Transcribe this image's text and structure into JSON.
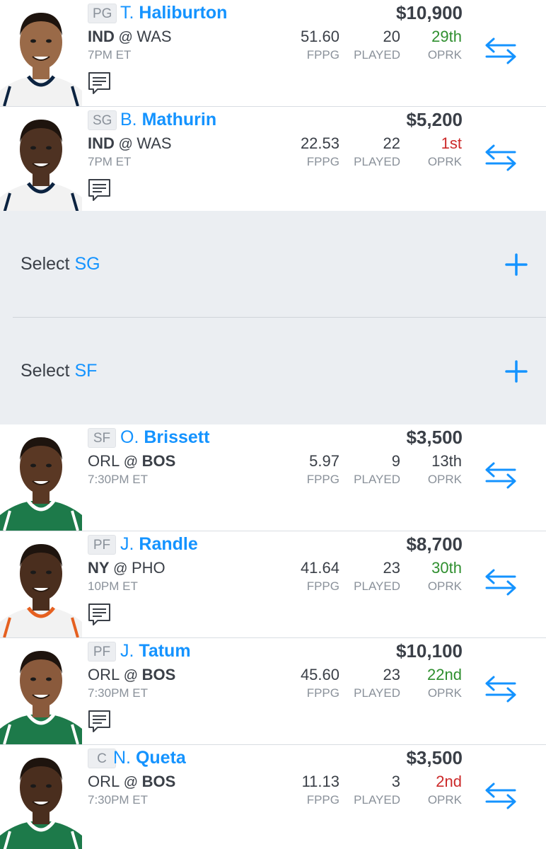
{
  "players": [
    {
      "pos": "PG",
      "first": "T.",
      "last": "Haliburton",
      "salary": "$10,900",
      "team": "IND",
      "at": "@",
      "opp": "WAS",
      "team_bold": "team",
      "time": "7PM ET",
      "fppg": "51.60",
      "played": "20",
      "oprk": "29th",
      "oprk_color": "#2f8f2f",
      "has_note": true,
      "jersey": "#f2f2f2",
      "trim": "#0c2340",
      "skin": "#9a6a48"
    },
    {
      "pos": "SG",
      "first": "B.",
      "last": "Mathurin",
      "salary": "$5,200",
      "team": "IND",
      "at": "@",
      "opp": "WAS",
      "team_bold": "team",
      "time": "7PM ET",
      "fppg": "22.53",
      "played": "22",
      "oprk": "1st",
      "oprk_color": "#cc2a2a",
      "has_note": true,
      "jersey": "#f2f2f2",
      "trim": "#0c2340",
      "skin": "#4e3222"
    },
    {
      "pos": "SF",
      "first": "O.",
      "last": "Brissett",
      "salary": "$3,500",
      "team": "ORL",
      "at": "@",
      "opp": "BOS",
      "team_bold": "opp",
      "time": "7:30PM ET",
      "fppg": "5.97",
      "played": "9",
      "oprk": "13th",
      "oprk_color": "#3a3f47",
      "has_note": false,
      "jersey": "#1d7a4a",
      "trim": "#ffffff",
      "skin": "#5a3824"
    },
    {
      "pos": "PF",
      "first": "J.",
      "last": "Randle",
      "salary": "$8,700",
      "team": "NY",
      "at": "@",
      "opp": "PHO",
      "team_bold": "team",
      "time": "10PM ET",
      "fppg": "41.64",
      "played": "23",
      "oprk": "30th",
      "oprk_color": "#2f8f2f",
      "has_note": true,
      "jersey": "#f2f2f2",
      "trim": "#e56020",
      "skin": "#4a2e1e"
    },
    {
      "pos": "PF",
      "first": "J.",
      "last": "Tatum",
      "salary": "$10,100",
      "team": "ORL",
      "at": "@",
      "opp": "BOS",
      "team_bold": "opp",
      "time": "7:30PM ET",
      "fppg": "45.60",
      "played": "23",
      "oprk": "22nd",
      "oprk_color": "#2f8f2f",
      "has_note": true,
      "jersey": "#1d7a4a",
      "trim": "#ffffff",
      "skin": "#8a5a3c"
    },
    {
      "pos": "C",
      "first": "N.",
      "last": "Queta",
      "salary": "$3,500",
      "team": "ORL",
      "at": "@",
      "opp": "BOS",
      "team_bold": "opp",
      "time": "7:30PM ET",
      "fppg": "11.13",
      "played": "3",
      "oprk": "2nd",
      "oprk_color": "#cc2a2a",
      "has_note": false,
      "jersey": "#1d7a4a",
      "trim": "#ffffff",
      "skin": "#4a2e1e"
    }
  ],
  "stat_labels": {
    "fppg": "FPPG",
    "played": "PLAYED",
    "oprk": "OPRK"
  },
  "empty_slots": [
    {
      "prefix": "Select",
      "pos": "SG"
    },
    {
      "prefix": "Select",
      "pos": "SF"
    }
  ],
  "colors": {
    "accent": "#1493ff",
    "good": "#2f8f2f",
    "bad": "#cc2a2a"
  },
  "icons": {
    "swap": "swap-arrows-icon",
    "add": "plus-icon",
    "note": "news-note-icon"
  }
}
